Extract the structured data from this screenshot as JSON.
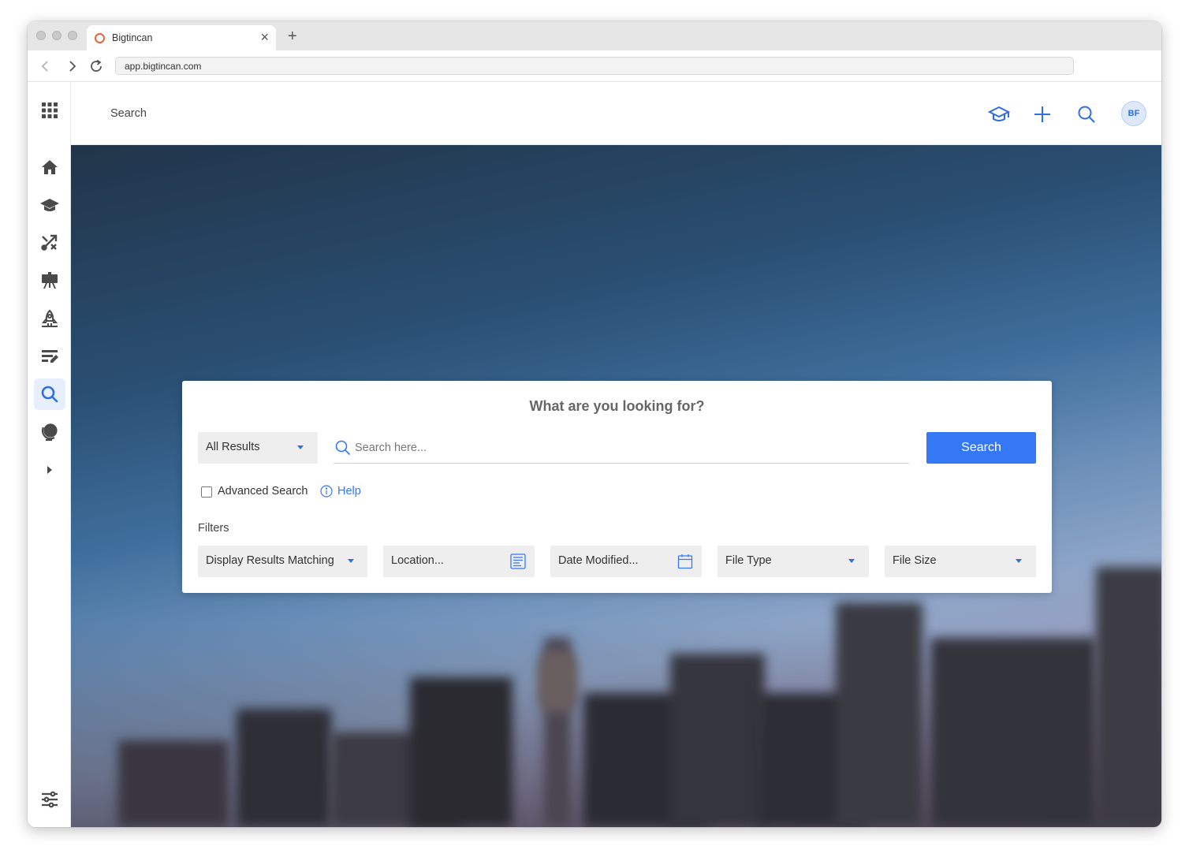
{
  "browser": {
    "tab_title": "Bigtincan",
    "url": "app.bigtincan.com",
    "new_tab_symbol": "+",
    "close_symbol": "×"
  },
  "sidebar": {
    "items": [
      {
        "name": "home-icon"
      },
      {
        "name": "graduation-cap-icon"
      },
      {
        "name": "shuffle-icon"
      },
      {
        "name": "presentation-easel-icon"
      },
      {
        "name": "rocket-icon"
      },
      {
        "name": "edit-notes-icon"
      },
      {
        "name": "search-icon",
        "active": true
      },
      {
        "name": "globe-icon"
      },
      {
        "name": "expand-arrow-icon"
      }
    ],
    "bottom": "settings-sliders-icon"
  },
  "header": {
    "title": "Search",
    "avatar_initials": "BF"
  },
  "search_card": {
    "heading": "What are you looking for?",
    "scope_select": "All Results",
    "search_placeholder": "Search here...",
    "search_button": "Search",
    "advanced_label": "Advanced Search",
    "help_label": "Help",
    "filters_label": "Filters",
    "filters": [
      {
        "label": "Display Results Matching"
      },
      {
        "label": "Location..."
      },
      {
        "label": "Date Modified..."
      },
      {
        "label": "File Type"
      },
      {
        "label": "File Size"
      }
    ]
  },
  "colors": {
    "accent": "#3478f6",
    "sidebar_active_bg": "#e7eefc",
    "icon_gray": "#4a4a4a"
  }
}
